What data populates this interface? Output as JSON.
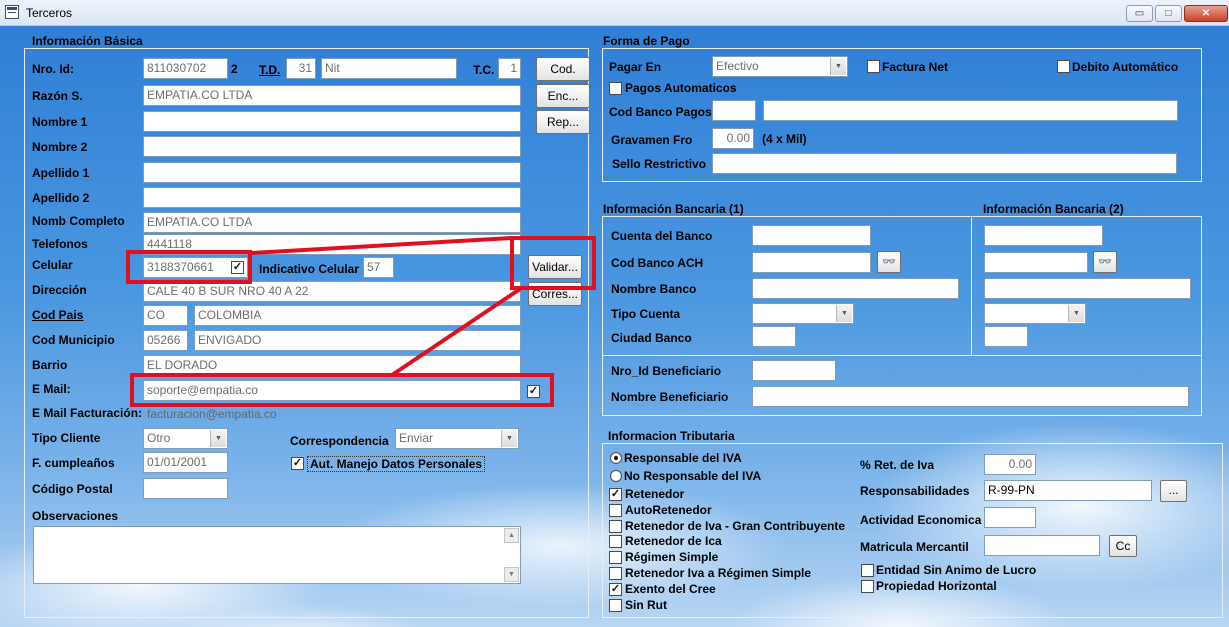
{
  "window": {
    "title": "Terceros",
    "minimize_glyph": "▭",
    "maximize_glyph": "□",
    "close_glyph": "✕"
  },
  "basic": {
    "title": "Información Básica",
    "nro_id_label": "Nro. Id:",
    "nro_id_value": "811030702",
    "dv": "2",
    "td_label": "T.D.",
    "td_value": "31",
    "td_desc": "Nit",
    "tc_label": "T.C.",
    "tc_value": "1",
    "razon_label": "Razón S.",
    "razon_value": "EMPATIA.CO LTDA",
    "nombre1_label": "Nombre 1",
    "nombre2_label": "Nombre 2",
    "apellido1_label": "Apellido 1",
    "apellido2_label": "Apellido 2",
    "nomb_completo_label": "Nomb Completo",
    "nomb_completo_value": "EMPATIA.CO LTDA",
    "telefonos_label": "Telefonos",
    "telefonos_value": "4441118",
    "celular_label": "Celular",
    "celular_value": "3188370661",
    "celular_checked": "✓",
    "indicativo_label": "Indicativo Celular",
    "indicativo_value": "57",
    "direccion_label": "Dirección",
    "direccion_value": "CALE 40 B SUR NRO 40 A 22",
    "cod_pais_label": "Cod Pais",
    "cod_pais_value": "CO",
    "pais_name": "COLOMBIA",
    "cod_municipio_label": "Cod Municipio",
    "cod_municipio_value": "05266",
    "municipio_name": "ENVIGADO",
    "barrio_label": "Barrio",
    "barrio_value": "EL DORADO",
    "email_label": "E Mail:",
    "email_value": "soporte@empatia.co",
    "email_checked": "✓",
    "email_fact_label": "E Mail Facturación:",
    "email_fact_value": "facturacion@empatia.co",
    "tipo_cliente_label": "Tipo Cliente",
    "tipo_cliente_value": "Otro",
    "correspondencia_label": "Correspondencia",
    "correspondencia_value": "Enviar",
    "cumple_label": "F. cumpleaños",
    "cumple_value": "01/01/2001",
    "aut_checked": "✓",
    "aut_label": "Aut. Manejo Datos Personales",
    "codigo_postal_label": "Código Postal",
    "observaciones_label": "Observaciones",
    "buttons": {
      "cod": "Cod.",
      "enc": "Enc...",
      "rep": "Rep...",
      "validar": "Validar...",
      "corres": "Corres..."
    }
  },
  "pago": {
    "title": "Forma de Pago",
    "pagar_en_label": "Pagar En",
    "pagar_en_value": "Efectivo",
    "factura_net_label": "Factura Net",
    "debito_label": "Debito Automático",
    "pagos_auto_label": "Pagos Automaticos",
    "cod_banco_pagos_label": "Cod Banco Pagos",
    "gravamen_label": "Gravamen Fro",
    "gravamen_value": "0.00",
    "gravamen_unit": "(4 x Mil)",
    "sello_label": "Sello Restrictivo"
  },
  "bancaria": {
    "title1": "Información Bancaria (1)",
    "title2": "Información Bancaria (2)",
    "cuenta_label": "Cuenta del Banco",
    "ach_label": "Cod Banco ACH",
    "nombre_banco_label": "Nombre Banco",
    "tipo_cuenta_label": "Tipo Cuenta",
    "ciudad_banco_label": "Ciudad Banco",
    "nro_benef_label": "Nro_Id Beneficiario",
    "nombre_benef_label": "Nombre Beneficiario",
    "binocular_glyph": "👓"
  },
  "tributaria": {
    "title": "Informacion Tributaria",
    "responsable": "Responsable del IVA",
    "no_responsable": "No Responsable del IVA",
    "retenedor": "Retenedor",
    "autoretenedor": "AutoRetenedor",
    "gran_contribuyente": "Retenedor de Iva - Gran Contribuyente",
    "retenedor_ica": "Retenedor de Ica",
    "regimen_simple": "Régimen Simple",
    "ret_iva_simple": "Retenedor Iva a Régimen Simple",
    "exento_cree": "Exento del Cree",
    "sin_rut": "Sin Rut",
    "check_glyph": "✓",
    "ret_iva_label": "% Ret. de Iva",
    "ret_iva_value": "0.00",
    "responsabilidades_label": "Responsabilidades",
    "responsabilidades_value": "R-99-PN",
    "resp_btn": "...",
    "actividad_label": "Actividad Economica",
    "matricula_label": "Matricula Mercantil",
    "cc_btn": "Cc",
    "sin_animo_label": "Entidad Sin Animo de Lucro",
    "propiedad_label": "Propiedad Horizontal"
  },
  "colors": {
    "highlight": "#e01020",
    "sky_top": "#2f7fd6"
  }
}
